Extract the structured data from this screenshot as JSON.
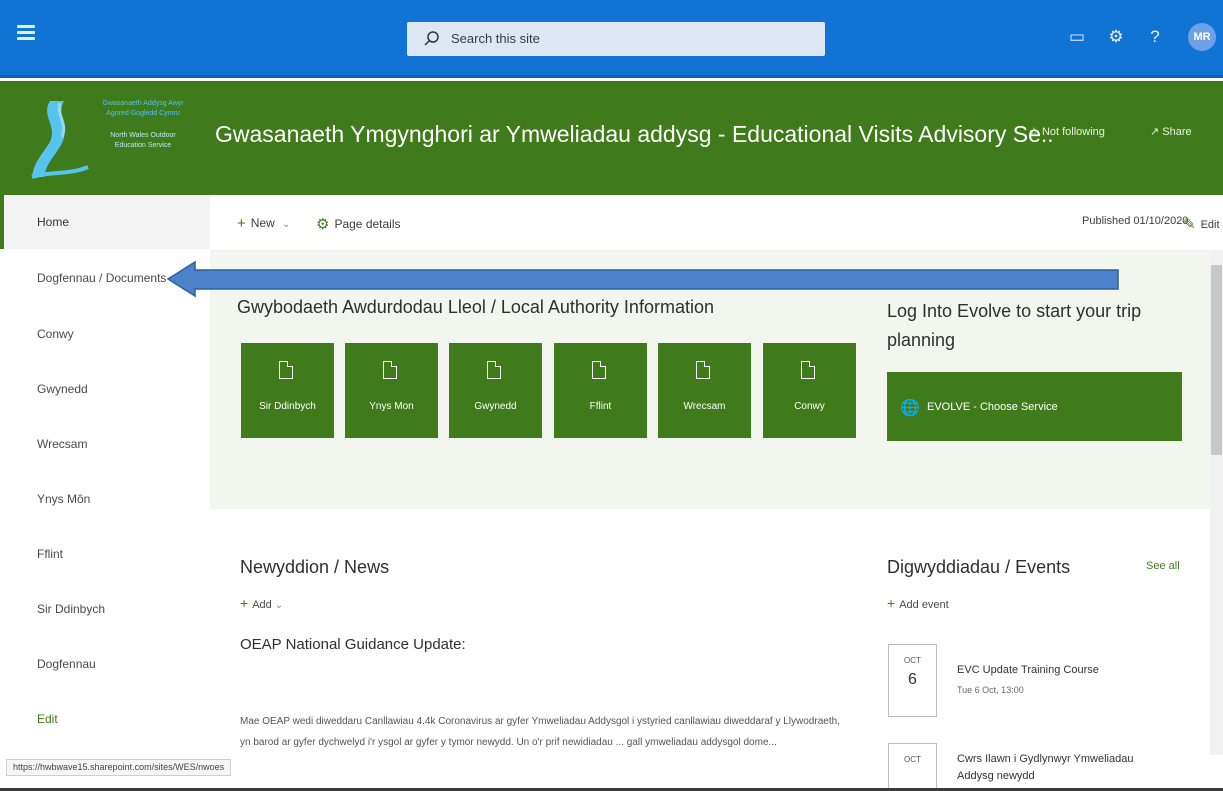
{
  "suitebar": {
    "search_placeholder": "Search this site",
    "avatar_initials": "MR"
  },
  "site": {
    "logo_lines_cy": [
      "Gwasanaeth Addysg Awyr",
      "Agored Gogledd Cymru"
    ],
    "logo_lines_en": [
      "North Wales Outdoor",
      "Education Service"
    ],
    "title": "Gwasanaeth Ymgynghori ar Ymweliadau addysg - Educational Visits Advisory Se..",
    "follow_label": "Not following",
    "share_label": "Share"
  },
  "leftnav": {
    "items": [
      {
        "label": "Home"
      },
      {
        "label": "Dogfennau / Documents"
      },
      {
        "label": "Conwy"
      },
      {
        "label": "Gwynedd"
      },
      {
        "label": "Wrecsam"
      },
      {
        "label": "Ynys Môn"
      },
      {
        "label": "Fflint"
      },
      {
        "label": "Sir Ddinbych"
      },
      {
        "label": "Dogfennau"
      },
      {
        "label": "Edit"
      }
    ]
  },
  "commandbar": {
    "new_label": "New",
    "page_details_label": "Page details",
    "published": "Published 01/10/2020",
    "edit_label": "Edit"
  },
  "hero": {
    "la_heading": "Gwybodaeth Awdurdodau Lleol / Local Authority Information",
    "tiles": [
      {
        "label": "Sir Ddinbych"
      },
      {
        "label": "Ynys Mon"
      },
      {
        "label": "Gwynedd"
      },
      {
        "label": "Fflint"
      },
      {
        "label": "Wrecsam"
      },
      {
        "label": "Conwy"
      }
    ],
    "evolve_heading": "Log Into Evolve to start your trip planning",
    "evolve_button": "EVOLVE - Choose Service"
  },
  "news": {
    "heading": "Newyddion / News",
    "add_label": "Add",
    "article_title": "OEAP National Guidance Update:",
    "article_body": "Mae OEAP wedi diweddaru Canllawiau 4.4k Coronavirus ar gyfer Ymweliadau Addysgol i ystyried canllawiau diweddaraf y Llywodraeth, yn barod ar gyfer dychwelyd i'r ysgol ar gyfer y tymor newydd. Un o'r prif newidiadau ... gall ymweliadau addysgol dome..."
  },
  "events": {
    "heading": "Digwyddiadau / Events",
    "see_all": "See all",
    "add_event": "Add event",
    "items": [
      {
        "month": "OCT",
        "day": "6",
        "title": "EVC Update Training Course",
        "time": "Tue 6 Oct, 13:00"
      },
      {
        "month": "OCT",
        "day": "",
        "title": "Cwrs Ilawn i Gydlynwyr Ymweliadau Addysg newydd",
        "time": ""
      }
    ]
  },
  "status_url": "https://hwbwave15.sharepoint.com/sites/WES/nwoes",
  "colors": {
    "suite_blue": "#1173d4",
    "site_green": "#3f7b1a",
    "hero_bg": "#f2f6ee",
    "arrow_blue": "#4a83c9"
  }
}
